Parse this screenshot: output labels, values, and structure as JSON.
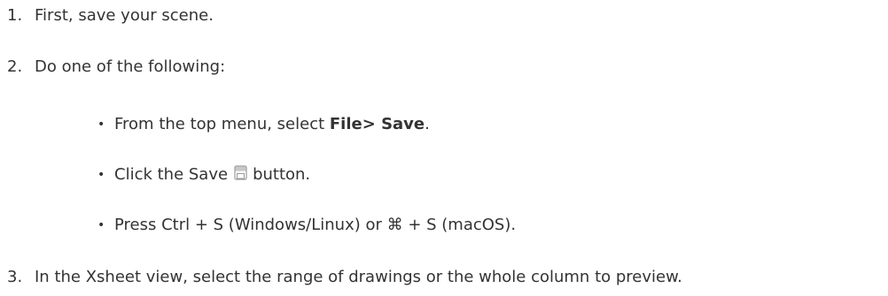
{
  "steps": [
    {
      "number": "1.",
      "text": "First, save your scene."
    },
    {
      "number": "2.",
      "text": "Do one of the following:"
    },
    {
      "number": "3.",
      "text": "In the Xsheet view, select the range of drawings or the whole column to preview."
    }
  ],
  "bullets": {
    "marker": "•",
    "item1": {
      "before": "From the top menu, select ",
      "bold": "File> Save",
      "after": "."
    },
    "item2": {
      "before": "Click the Save",
      "icon": "save-icon",
      "after": "button."
    },
    "item3": {
      "text": "Press Ctrl + S (Windows/Linux) or ⌘ + S (macOS)."
    }
  }
}
